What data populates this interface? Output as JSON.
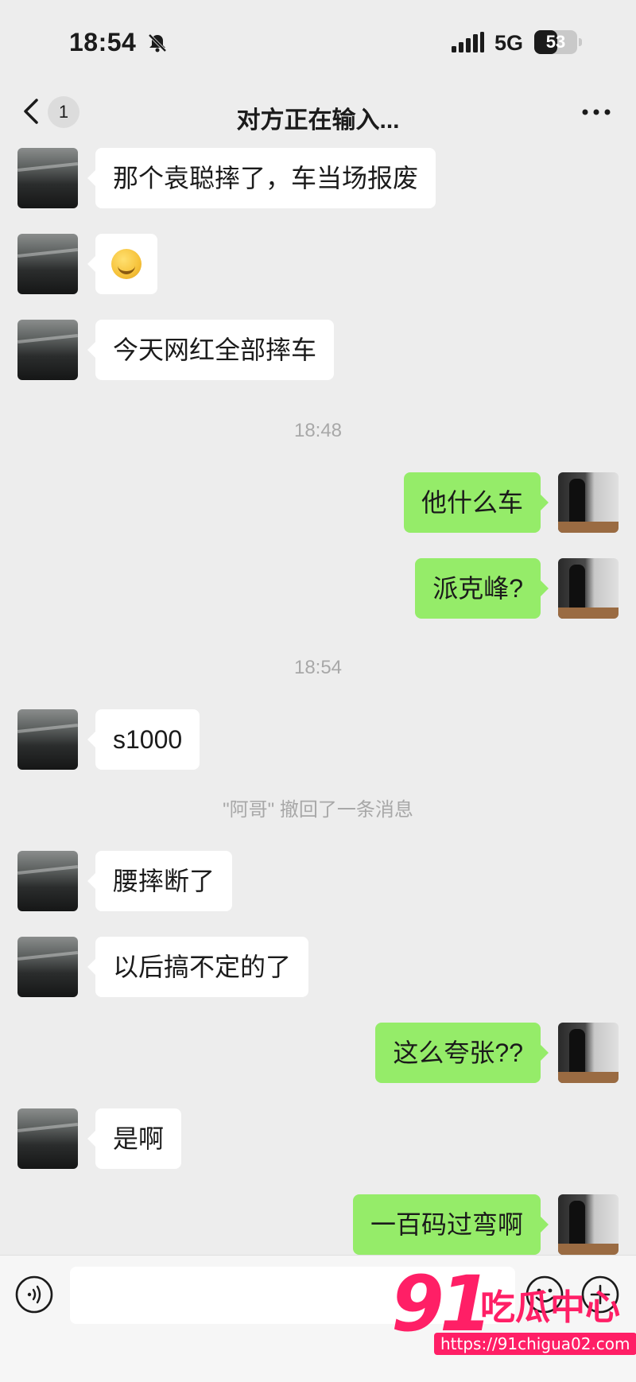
{
  "status_bar": {
    "time": "18:54",
    "network": "5G",
    "battery": "53",
    "battery_level": 0.53
  },
  "nav": {
    "unread_badge": "1",
    "title": "对方正在输入..."
  },
  "messages": [
    {
      "side": "left",
      "type": "text",
      "text": "那个袁聪摔了，车当场报废"
    },
    {
      "side": "left",
      "type": "emoji",
      "text": ""
    },
    {
      "side": "left",
      "type": "text",
      "text": "今天网红全部摔车"
    },
    {
      "side": "timestamp",
      "text": "18:48"
    },
    {
      "side": "right",
      "type": "text",
      "text": "他什么车"
    },
    {
      "side": "right",
      "type": "text",
      "text": "派克峰?"
    },
    {
      "side": "timestamp",
      "text": "18:54"
    },
    {
      "side": "left",
      "type": "text",
      "text": "s1000"
    },
    {
      "side": "system",
      "text": "\"阿哥\" 撤回了一条消息"
    },
    {
      "side": "left",
      "type": "text",
      "text": "腰摔断了"
    },
    {
      "side": "left",
      "type": "text",
      "text": "以后搞不定的了"
    },
    {
      "side": "right",
      "type": "text",
      "text": "这么夸张??"
    },
    {
      "side": "left",
      "type": "text",
      "text": "是啊"
    },
    {
      "side": "right",
      "type": "text",
      "text": "一百码过弯啊"
    }
  ],
  "input_bar": {
    "voice_icon": "voice-icon",
    "emoji_icon": "smiley-icon",
    "plus_icon": "plus-icon"
  },
  "watermark": {
    "number": "91",
    "brand": "吃瓜中心",
    "url": "https://91chigua02.com"
  },
  "colors": {
    "background": "#ededed",
    "sent_bubble": "#95ec69",
    "received_bubble": "#ffffff",
    "watermark": "#ff1f66"
  }
}
